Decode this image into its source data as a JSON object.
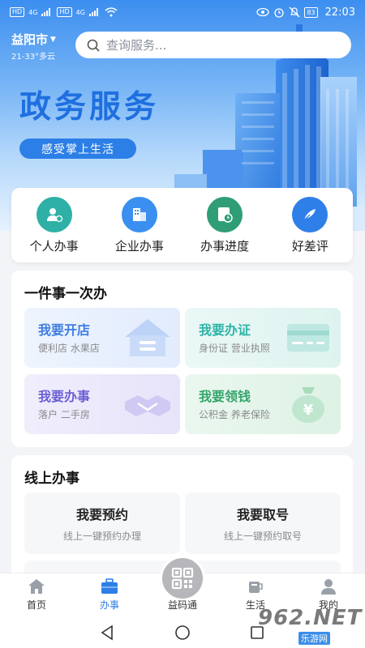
{
  "status_bar": {
    "chip_hd": "HD",
    "chip_hd2": "HD",
    "signal_1": "4G",
    "signal_2": "4G",
    "battery": "83",
    "time": "22:03"
  },
  "header": {
    "city": "益阳市",
    "weather": "21-33°多云",
    "search_placeholder": "查询服务..."
  },
  "hero": {
    "title": "政务服务",
    "tagline": "感受掌上生活"
  },
  "quick_menu": [
    {
      "label": "个人办事",
      "icon": "person-icon",
      "color": "#2fb0a6"
    },
    {
      "label": "企业办事",
      "icon": "building-icon",
      "color": "#3a8ff0"
    },
    {
      "label": "办事进度",
      "icon": "progress-icon",
      "color": "#2f9e76"
    },
    {
      "label": "好差评",
      "icon": "feather-icon",
      "color": "#2f7fe8"
    }
  ],
  "one_thing": {
    "title": "一件事一次办",
    "tiles": [
      {
        "title": "我要开店",
        "sub": "便利店 水果店",
        "icon": "shop-icon",
        "color": "#3f7de0"
      },
      {
        "title": "我要办证",
        "sub": "身份证 营业执照",
        "icon": "id-card-icon",
        "color": "#2fb3a8"
      },
      {
        "title": "我要办事",
        "sub": "落户 二手房",
        "icon": "handshake-icon",
        "color": "#6b5fd6"
      },
      {
        "title": "我要领钱",
        "sub": "公积金 养老保险",
        "icon": "money-bag-icon",
        "color": "#35a56b"
      }
    ]
  },
  "online": {
    "title": "线上办事",
    "tiles": [
      {
        "title": "我要预约",
        "sub": "线上一键预约办理"
      },
      {
        "title": "我要取号",
        "sub": "线上一键预约取号"
      }
    ]
  },
  "tabbar": {
    "tabs": [
      {
        "label": "首页",
        "icon": "home-icon"
      },
      {
        "label": "办事",
        "icon": "briefcase-icon"
      },
      {
        "label": "益码通",
        "icon": "qr-code-icon"
      },
      {
        "label": "生活",
        "icon": "cup-icon"
      },
      {
        "label": "我的",
        "icon": "profile-icon"
      }
    ],
    "active": "办事"
  },
  "watermark": {
    "main": "962.NET",
    "sub": "乐游网"
  },
  "colors": {
    "primary": "#2c7fe6",
    "hero_title": "#1f6fe0"
  }
}
